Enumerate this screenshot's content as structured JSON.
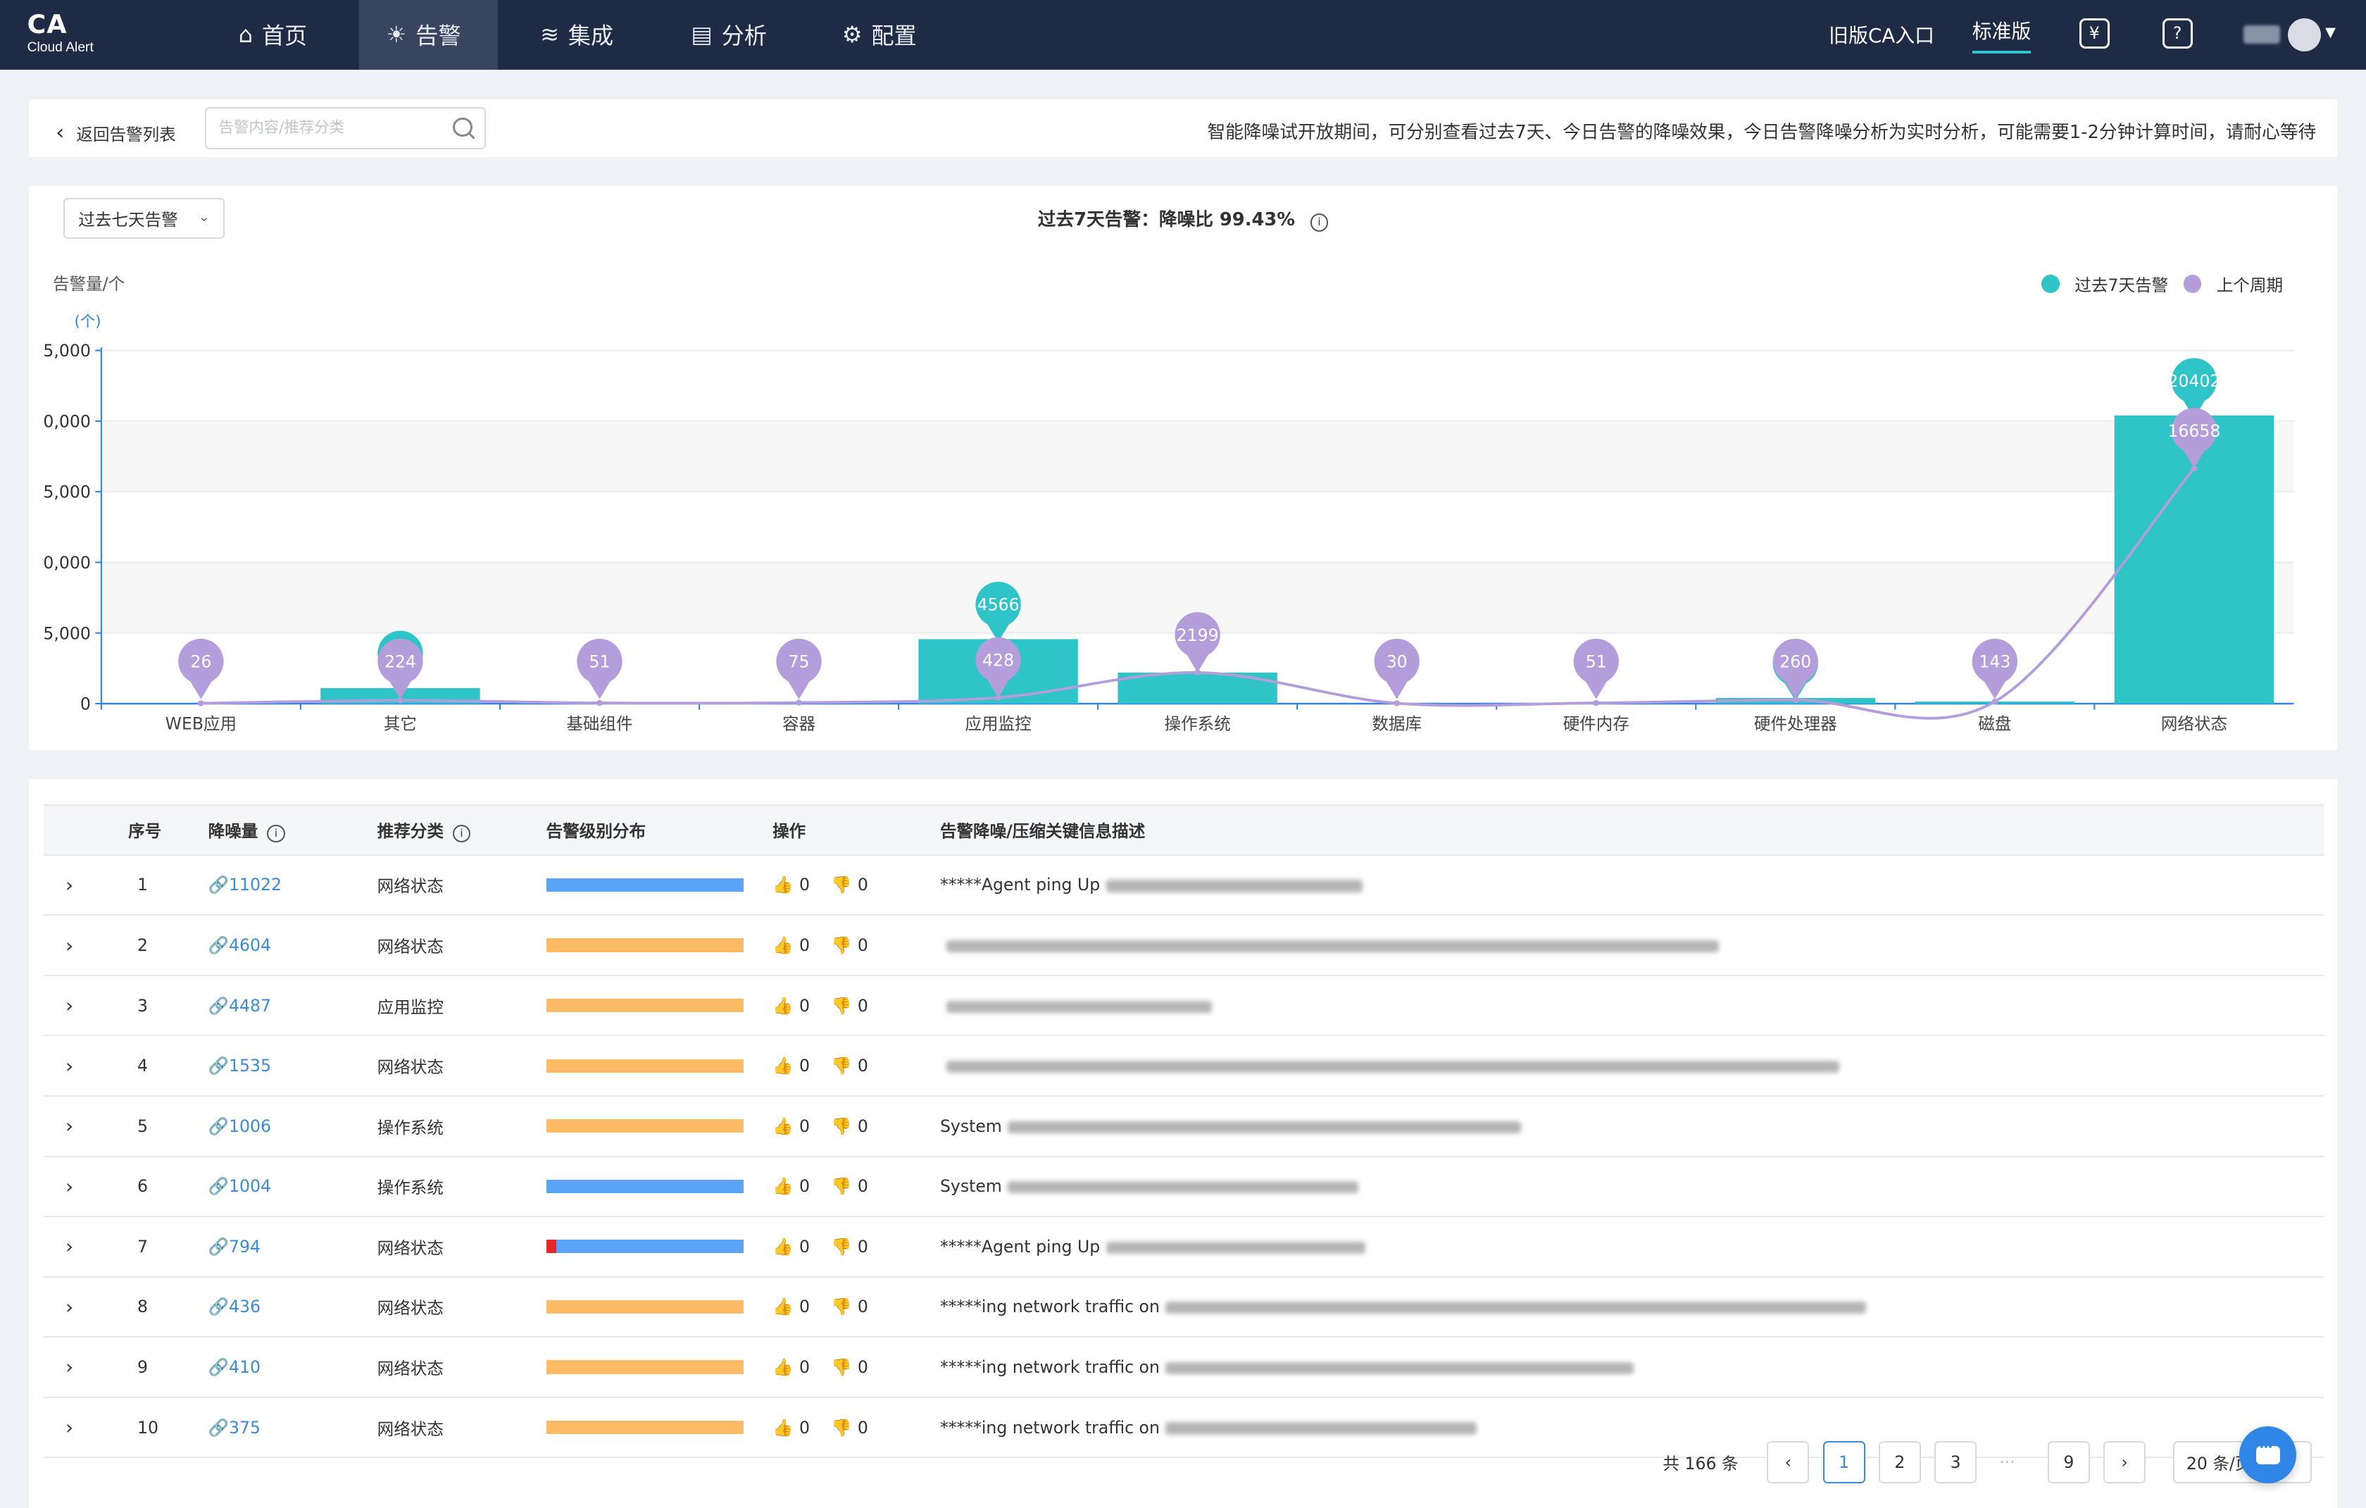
{
  "app": {
    "logo": "CA",
    "logo_sub": "Cloud Alert"
  },
  "nav": [
    {
      "label": "首页",
      "icon": "home-icon"
    },
    {
      "label": "告警",
      "icon": "alarm-icon",
      "active": true
    },
    {
      "label": "集成",
      "icon": "layers-icon"
    },
    {
      "label": "分析",
      "icon": "chart-icon"
    },
    {
      "label": "配置",
      "icon": "gear-icon"
    }
  ],
  "header_right": {
    "old_entry": "旧版CA入口",
    "standard": "标准版",
    "yen_icon": "¥",
    "help_icon": "?"
  },
  "toolbar": {
    "back_label": "返回告警列表",
    "search_placeholder": "告警内容/推荐分类",
    "notice": "智能降噪试开放期间，可分别查看过去7天、今日告警的降噪效果，今日告警降噪分析为实时分析，可能需要1-2分钟计算时间，请耐心等待"
  },
  "chart_panel": {
    "range_select": "过去七天告警",
    "title": "过去7天告警：降噪比 99.43%",
    "y_caption": "告警量/个",
    "legend": [
      {
        "name": "过去7天告警",
        "color": "#2ec4c8"
      },
      {
        "name": "上个周期",
        "color": "#b39ddb"
      }
    ]
  },
  "chart_data": {
    "type": "bar",
    "ylabel": "(个)",
    "ylim": [
      0,
      25000
    ],
    "ytick_labels": [
      "0",
      "5,000",
      "0,000",
      "5,000",
      "0,000",
      "5,000"
    ],
    "categories": [
      "WEB应用",
      "其它",
      "基础组件",
      "容器",
      "应用监控",
      "操作系统",
      "数据库",
      "硬件内存",
      "硬件处理器",
      "磁盘",
      "网络状态"
    ],
    "series": [
      {
        "name": "过去7天告警",
        "type": "bar",
        "color": "#2ec4c8",
        "values": [
          0,
          1100,
          0,
          0,
          4566,
          2199,
          0,
          0,
          400,
          150,
          20402
        ]
      },
      {
        "name": "上个周期",
        "type": "line",
        "color": "#b39ddb",
        "values": [
          26,
          224,
          51,
          75,
          428,
          2199,
          30,
          51,
          260,
          143,
          16658
        ]
      }
    ],
    "markers_current": [
      {
        "index": 1,
        "label": ""
      },
      {
        "index": 4,
        "label": "4566"
      },
      {
        "index": 8,
        "label": ""
      },
      {
        "index": 10,
        "label": "20402"
      }
    ]
  },
  "table": {
    "columns": [
      "",
      "序号",
      "降噪量",
      "推荐分类",
      "告警级别分布",
      "操作",
      "告警降噪/压缩关键信息描述"
    ],
    "rows": [
      {
        "no": "1",
        "count": "11022",
        "category": "网络状态",
        "dist": [
          [
            "#5ba4f5",
            1
          ]
        ],
        "up": "0",
        "down": "0",
        "desc": "*****Agent ping Up",
        "blur_w": 170
      },
      {
        "no": "2",
        "count": "4604",
        "category": "网络状态",
        "dist": [
          [
            "#fdbb65",
            1
          ]
        ],
        "up": "0",
        "down": "0",
        "desc": "",
        "blur_w": 512
      },
      {
        "no": "3",
        "count": "4487",
        "category": "应用监控",
        "dist": [
          [
            "#fdbb65",
            1
          ]
        ],
        "up": "0",
        "down": "0",
        "desc": "",
        "blur_w": 176
      },
      {
        "no": "4",
        "count": "1535",
        "category": "网络状态",
        "dist": [
          [
            "#fdbb65",
            1
          ]
        ],
        "up": "0",
        "down": "0",
        "desc": "",
        "blur_w": 592
      },
      {
        "no": "5",
        "count": "1006",
        "category": "操作系统",
        "dist": [
          [
            "#fdbb65",
            1
          ]
        ],
        "up": "0",
        "down": "0",
        "desc": "System",
        "blur_w": 340
      },
      {
        "no": "6",
        "count": "1004",
        "category": "操作系统",
        "dist": [
          [
            "#5ba4f5",
            1
          ]
        ],
        "up": "0",
        "down": "0",
        "desc": "System",
        "blur_w": 232
      },
      {
        "no": "7",
        "count": "794",
        "category": "网络状态",
        "dist": [
          [
            "#e8262a",
            0.05
          ],
          [
            "#5ba4f5",
            0.95
          ]
        ],
        "up": "0",
        "down": "0",
        "desc": "*****Agent ping Up",
        "blur_w": 172
      },
      {
        "no": "8",
        "count": "436",
        "category": "网络状态",
        "dist": [
          [
            "#fdbb65",
            1
          ]
        ],
        "up": "0",
        "down": "0",
        "desc": "*****ing network traffic on",
        "blur_w": 464
      },
      {
        "no": "9",
        "count": "410",
        "category": "网络状态",
        "dist": [
          [
            "#fdbb65",
            1
          ]
        ],
        "up": "0",
        "down": "0",
        "desc": "*****ing network traffic on",
        "blur_w": 310
      },
      {
        "no": "10",
        "count": "375",
        "category": "网络状态",
        "dist": [
          [
            "#fdbb65",
            1
          ]
        ],
        "up": "0",
        "down": "0",
        "desc": "*****ing network traffic on",
        "blur_w": 206
      }
    ]
  },
  "pagination": {
    "total_label": "共 166 条",
    "pages": [
      "1",
      "2",
      "3",
      "9"
    ],
    "ellipsis": "···",
    "current": "1",
    "page_size": "20 条/页"
  }
}
